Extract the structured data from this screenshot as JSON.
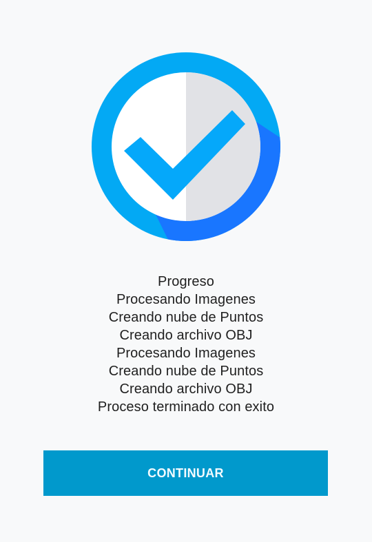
{
  "status": {
    "icon": "check-circle-icon",
    "colors": {
      "ring": "#03a9f4",
      "shadow": "#1976ff",
      "disc_light": "#ffffff",
      "disc_shade": "#e1e2e6",
      "check": "#05a8fa"
    }
  },
  "progress_log": {
    "lines": [
      "Progreso",
      "Procesando Imagenes",
      "Creando nube de Puntos",
      "Creando archivo OBJ",
      "Procesando Imagenes",
      "Creando nube de Puntos",
      "Creando archivo OBJ",
      "Proceso terminado con exito"
    ]
  },
  "actions": {
    "continue_label": "CONTINUAR",
    "button_color": "#0199cc"
  }
}
